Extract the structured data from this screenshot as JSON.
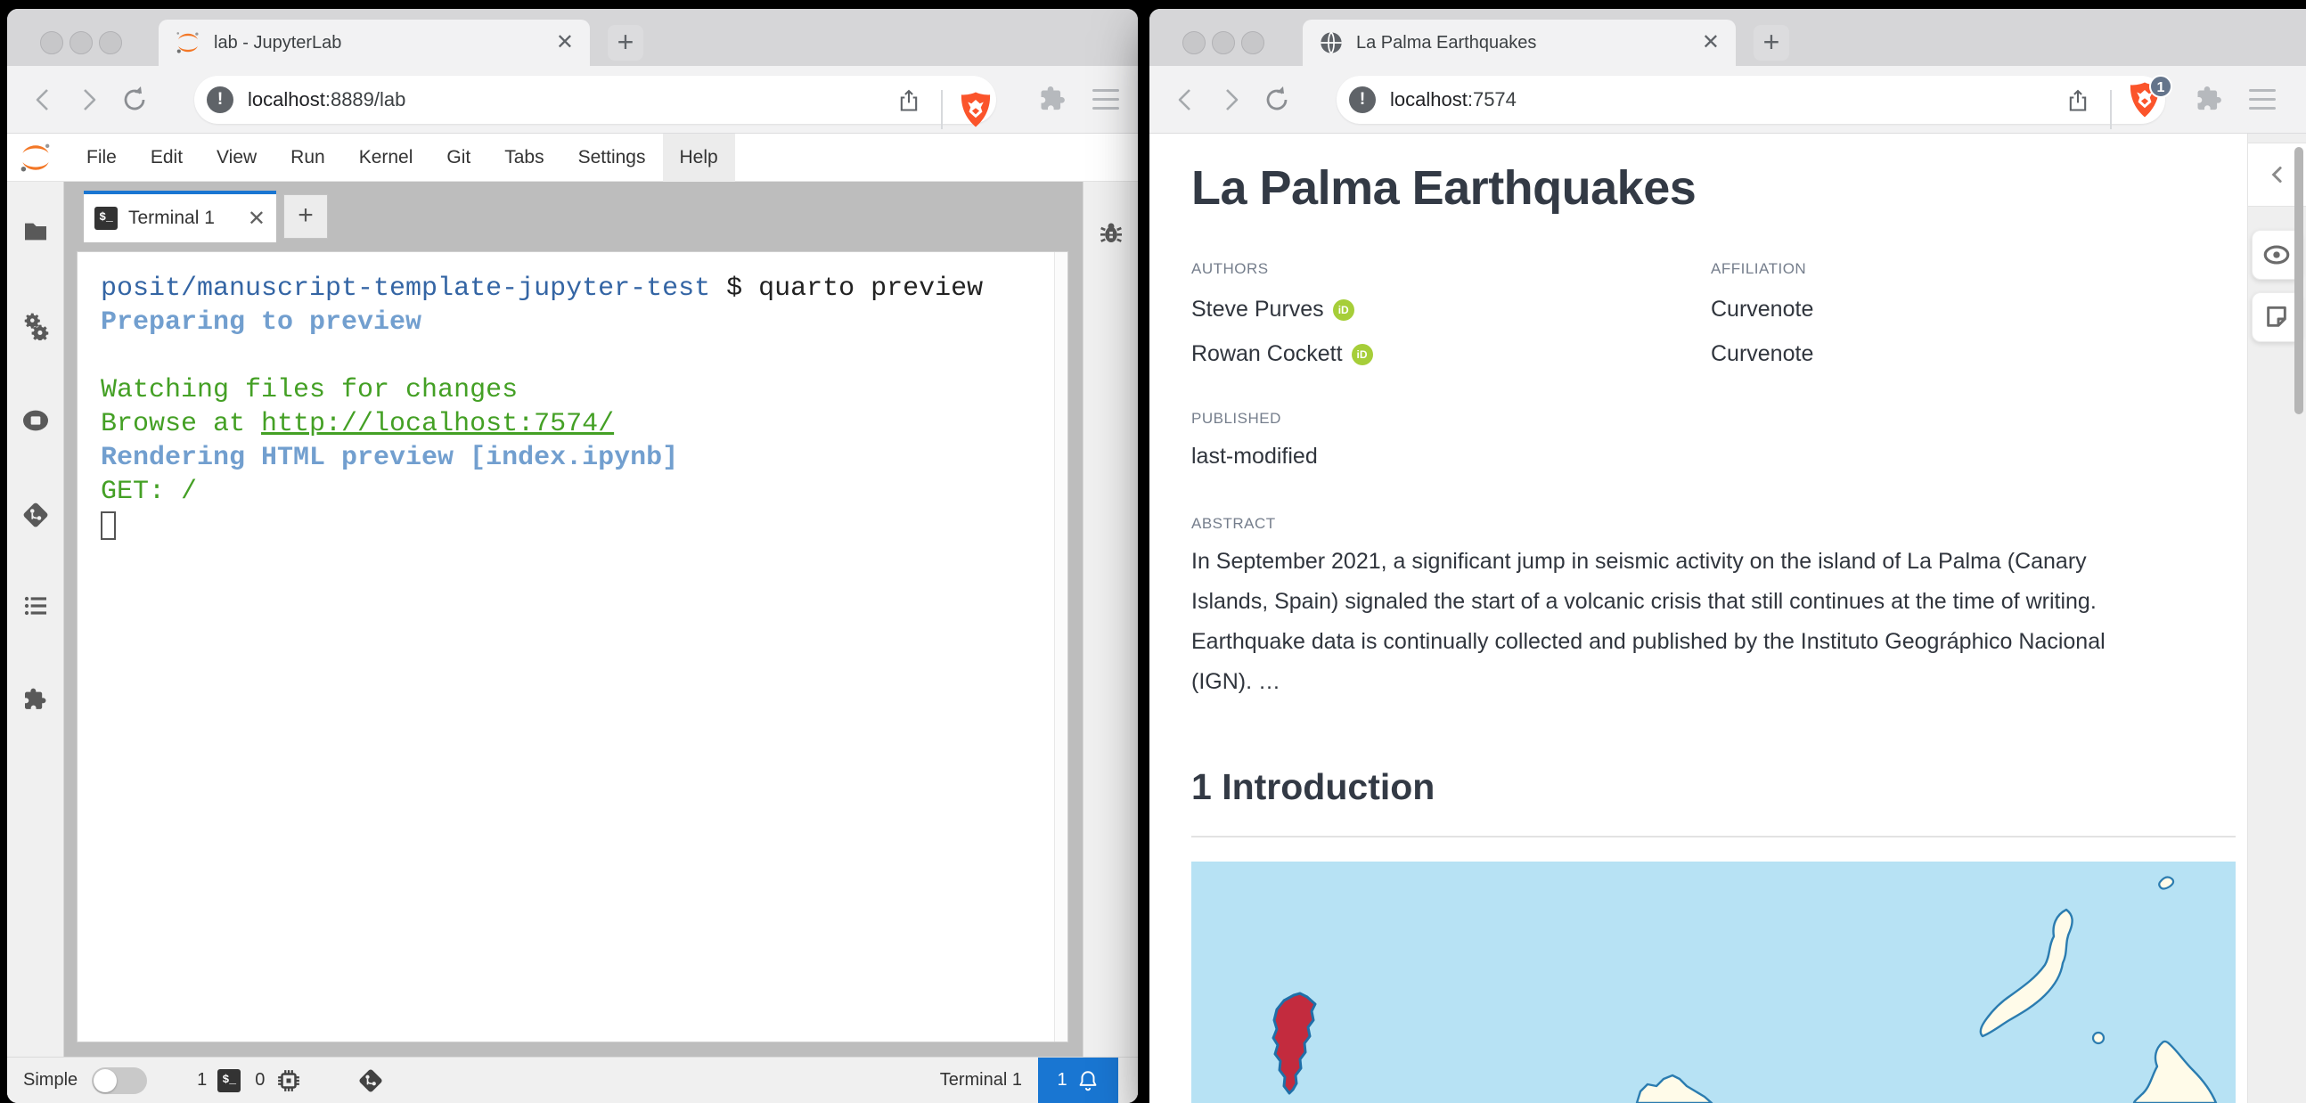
{
  "left_window": {
    "tab": {
      "title": "lab - JupyterLab"
    },
    "toolbar": {
      "url_host": "localhost",
      "url_rest": ":8889/lab"
    },
    "menu": {
      "items": [
        "File",
        "Edit",
        "View",
        "Run",
        "Kernel",
        "Git",
        "Tabs",
        "Settings",
        "Help"
      ]
    },
    "dock": {
      "terminal_tab_label": "Terminal 1",
      "terminal_glyph": "$_"
    },
    "terminal": {
      "line1_path": "posit/manuscript-template-jupyter-test",
      "line1_cmd": " $ quarto preview",
      "line2": "Preparing to preview",
      "line4": "Watching files for changes",
      "line5_prefix": "Browse at ",
      "line5_link": "http://localhost:7574/",
      "line6": "Rendering HTML preview [index.ipynb]",
      "line7": "GET: /"
    },
    "statusbar": {
      "mode_label": "Simple",
      "terminals_count": "1",
      "kernels_count": "0",
      "context_label": "Terminal 1",
      "notifications_count": "1"
    }
  },
  "right_window": {
    "tab": {
      "title": "La Palma Earthquakes"
    },
    "toolbar": {
      "url_host": "localhost",
      "url_rest": ":7574",
      "brave_badge": "1"
    },
    "article": {
      "title": "La Palma Earthquakes",
      "authors_label": "AUTHORS",
      "affiliation_label": "AFFILIATION",
      "authors": [
        {
          "name": "Steve Purves",
          "orcid": "iD",
          "affiliation": "Curvenote"
        },
        {
          "name": "Rowan Cockett",
          "orcid": "iD",
          "affiliation": "Curvenote"
        }
      ],
      "published_label": "PUBLISHED",
      "published_value": "last-modified",
      "abstract_label": "ABSTRACT",
      "abstract_text": "In September 2021, a significant jump in seismic activity on the island of La Palma (Canary Islands, Spain) signaled the start of a volcanic crisis that still continues at the time of writing. Earthquake data is continually collected and published by the Instituto Geográphico Nacional (IGN). …",
      "section1_number": "1",
      "section1_title": "Introduction"
    },
    "map_colors": {
      "sea": "#b7e2f4",
      "island": "#fffbe9",
      "island_stroke": "#2b7cb0",
      "highlight": "#c32b3e",
      "highlight_stroke": "#1f6fa8"
    }
  },
  "icons": {
    "traffic_lights": [
      "close",
      "minimize",
      "zoom"
    ],
    "browser_toolbar": [
      "back",
      "forward",
      "reload",
      "site-info",
      "share",
      "brave-shield",
      "extensions",
      "menu"
    ],
    "jupyter_left_sidebar": [
      "file-browser",
      "property-inspector",
      "running-sessions",
      "git",
      "table-of-contents",
      "extension-manager"
    ],
    "jupyter_right_sidebar": [
      "debugger-bug"
    ],
    "statusbar_icons": [
      "terminal",
      "kernel-chip",
      "git-branch",
      "bell"
    ],
    "article_side_panel": [
      "collapse-chevron",
      "visibility-eye",
      "annotation-note"
    ]
  }
}
